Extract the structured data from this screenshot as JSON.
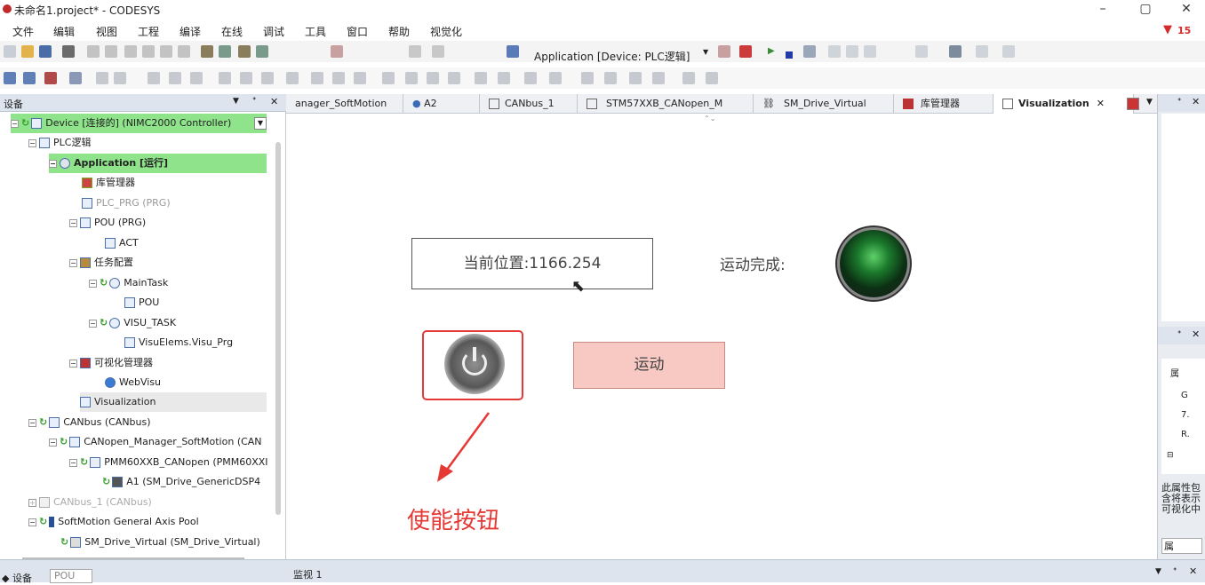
{
  "window": {
    "title": "未命名1.project* - CODESYS",
    "minimize": "–",
    "restore": "▢",
    "close": "✕"
  },
  "menu": [
    "文件",
    "编辑",
    "视图",
    "工程",
    "编译",
    "在线",
    "调试",
    "工具",
    "窗口",
    "帮助",
    "视觉化"
  ],
  "error_count": "15",
  "toolbar": {
    "application_label": "Application [Device: PLC逻辑]"
  },
  "devices_panel": {
    "title": "设备",
    "pin": "⊣ ✕"
  },
  "tree": [
    {
      "label": "Device [连接的] (NIMC2000 Controller)",
      "indent": 0,
      "highlight": true
    },
    {
      "label": "PLC逻辑",
      "indent": 1
    },
    {
      "label": "Application [运行]",
      "indent": 2,
      "highlight": true,
      "bold": true
    },
    {
      "label": "库管理器",
      "indent": 3
    },
    {
      "label": "PLC_PRG (PRG)",
      "indent": 3,
      "grey": true
    },
    {
      "label": "POU (PRG)",
      "indent": 3
    },
    {
      "label": "ACT",
      "indent": 4
    },
    {
      "label": "任务配置",
      "indent": 3
    },
    {
      "label": "MainTask",
      "indent": 4
    },
    {
      "label": "POU",
      "indent": 5
    },
    {
      "label": "VISU_TASK",
      "indent": 4
    },
    {
      "label": "VisuElems.Visu_Prg",
      "indent": 5
    },
    {
      "label": "可视化管理器",
      "indent": 3
    },
    {
      "label": "WebVisu",
      "indent": 4
    },
    {
      "label": "Visualization",
      "indent": 3,
      "selected": true
    },
    {
      "label": "CANbus (CANbus)",
      "indent": 1
    },
    {
      "label": "CANopen_Manager_SoftMotion (CAN",
      "indent": 2
    },
    {
      "label": "PMM60XXB_CANopen (PMM60XXI",
      "indent": 3
    },
    {
      "label": "A1 (SM_Drive_GenericDSP4",
      "indent": 4
    },
    {
      "label": "CANbus_1 (CANbus)",
      "indent": 1,
      "grey": true
    },
    {
      "label": "SoftMotion General Axis Pool",
      "indent": 1
    },
    {
      "label": "SM_Drive_Virtual (SM_Drive_Virtual)",
      "indent": 2
    }
  ],
  "tabs": [
    "anager_SoftMotion",
    "A2",
    "CANbus_1",
    "STM57XXB_CANopen_M",
    "SM_Drive_Virtual",
    "库管理器",
    "Visualization"
  ],
  "visu": {
    "position_text": "当前位置:1166.254",
    "motion_done_label": "运动完成:",
    "motion_button": "运动",
    "annotation": "使能按钮"
  },
  "right_panel": {
    "col1": [
      "属",
      "G",
      "7.",
      "R."
    ],
    "text": "此属性包含将表示可视化中"
  },
  "bottom": {
    "tab1": "设备",
    "tab2": "POU",
    "watch": "监视 1"
  },
  "colors": {
    "accent_green": "#8fe38b",
    "annotation_red": "#e53935",
    "motion_button_bg": "#f8c9c3"
  }
}
